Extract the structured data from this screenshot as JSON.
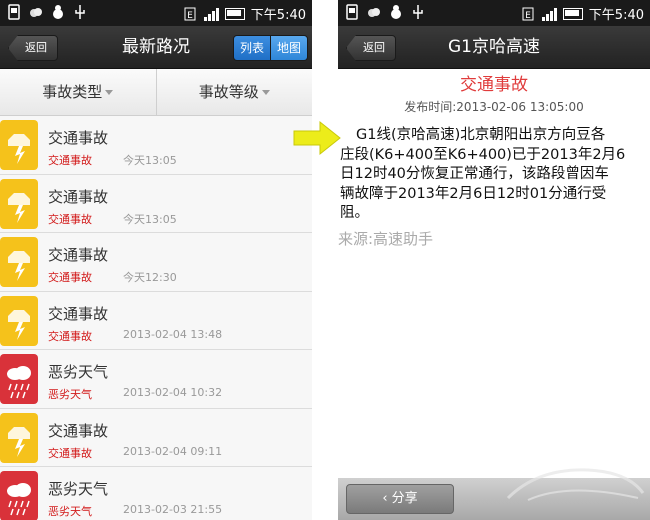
{
  "status_bar": {
    "time": "下午5:40"
  },
  "left": {
    "back_label": "返回",
    "title": "最新路况",
    "toggle": {
      "list": "列表",
      "map": "地图"
    },
    "filters": [
      "事故类型",
      "事故等级"
    ],
    "items": [
      {
        "title": "交通事故",
        "category": "交通事故",
        "time": "今天13:05",
        "kind": "accident"
      },
      {
        "title": "交通事故",
        "category": "交通事故",
        "time": "今天13:05",
        "kind": "accident"
      },
      {
        "title": "交通事故",
        "category": "交通事故",
        "time": "今天12:30",
        "kind": "accident"
      },
      {
        "title": "交通事故",
        "category": "交通事故",
        "time": "2013-02-04 13:48",
        "kind": "accident"
      },
      {
        "title": "恶劣天气",
        "category": "恶劣天气",
        "time": "2013-02-04 10:32",
        "kind": "weather"
      },
      {
        "title": "交通事故",
        "category": "交通事故",
        "time": "2013-02-04 09:11",
        "kind": "accident"
      },
      {
        "title": "恶劣天气",
        "category": "恶劣天气",
        "time": "2013-02-03 21:55",
        "kind": "weather"
      }
    ]
  },
  "right": {
    "back_label": "返回",
    "title": "G1京哈高速",
    "heading": "交通事故",
    "published": "发布时间:2013-02-06 13:05:00",
    "body_lines": [
      "G1线(京哈高速)北京朝阳出京方向豆各",
      "庄段(K6+400至K6+400)已于2013年2月6",
      "日12时40分恢复正常通行，该路段曾因车",
      "辆故障于2013年2月6日12时01分通行受",
      "阻。"
    ],
    "source": "来源:高速助手",
    "share_label": "分享"
  },
  "colors": {
    "accident_icon": "#f5c21b",
    "weather_icon": "#d9323a",
    "toggle_active": "#1f6fc6",
    "heading": "#e03c3c"
  }
}
